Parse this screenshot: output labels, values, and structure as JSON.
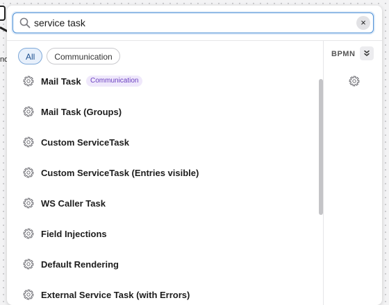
{
  "search": {
    "value": "service task",
    "placeholder": "",
    "clear_label": "×"
  },
  "filters": [
    {
      "label": "All",
      "active": true
    },
    {
      "label": "Communication",
      "active": false
    }
  ],
  "entries": [
    {
      "label": "Mail Task",
      "badge": "Communication",
      "icon": "gear-icon"
    },
    {
      "label": "Mail Task (Groups)",
      "icon": "gear-icon"
    },
    {
      "label": "Custom ServiceTask",
      "icon": "gear-icon"
    },
    {
      "label": "Custom ServiceTask (Entries visible)",
      "icon": "gear-icon"
    },
    {
      "label": "WS Caller Task",
      "icon": "gear-icon"
    },
    {
      "label": "Field Injections",
      "icon": "gear-icon"
    },
    {
      "label": "Default Rendering",
      "icon": "gear-icon"
    },
    {
      "label": "External Service Task (with Errors)",
      "icon": "gear-icon"
    }
  ],
  "group_panel": {
    "label": "BPMN",
    "collapse_icon": "chevron-double-down-icon",
    "item_icon": "gear-icon"
  },
  "canvas": {
    "partial_label": "nd"
  },
  "colors": {
    "accent": "#4d90d6",
    "badge_bg": "#efe8fb",
    "badge_text": "#6a3fc1"
  }
}
